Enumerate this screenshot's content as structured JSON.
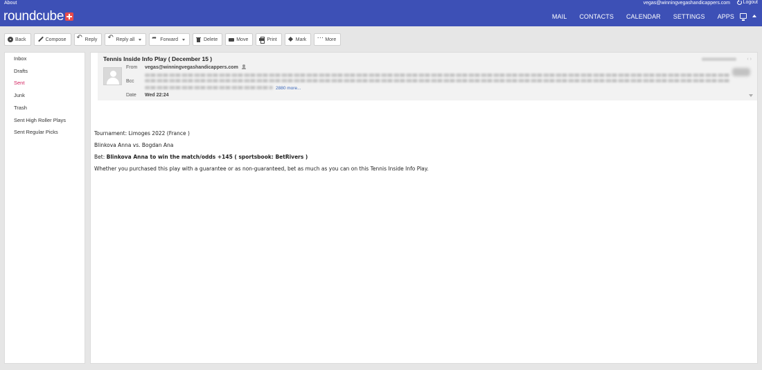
{
  "app": {
    "about_label": "About",
    "user_email": "vegas@winningvegashandicappers.com",
    "logout_label": "Logout",
    "logo_text": "roundcube",
    "nav": [
      "MAIL",
      "CONTACTS",
      "CALENDAR",
      "SETTINGS",
      "APPS"
    ]
  },
  "toolbar": {
    "back": "Back",
    "compose": "Compose",
    "reply": "Reply",
    "reply_all": "Reply all",
    "forward": "Forward",
    "delete": "Delete",
    "move": "Move",
    "print": "Print",
    "mark": "Mark",
    "more": "More"
  },
  "folders": [
    {
      "label": "Inbox",
      "active": false
    },
    {
      "label": "Drafts",
      "active": false
    },
    {
      "label": "Sent",
      "active": true
    },
    {
      "label": "Junk",
      "active": false
    },
    {
      "label": "Trash",
      "active": false
    },
    {
      "label": "Sent High Roller Plays",
      "active": false
    },
    {
      "label": "Sent Regular Picks",
      "active": false
    }
  ],
  "message": {
    "subject": "Tennis Inside Info Play ( December 15 )",
    "from_label": "From",
    "from": "vegas@winningvegashandicappers.com",
    "bcc_label": "Bcc",
    "bcc_more": "2880 more...",
    "date_label": "Date",
    "date": "Wed 22:24",
    "body": {
      "tournament": "Tournament: Limoges 2022 (France )",
      "match": "Blinkova Anna vs. Bogdan Ana",
      "bet_prefix": "Bet: ",
      "bet": "Blinkova Anna to win the match/odds +145 ( sportsbook: BetRivers )",
      "note": "Whether you purchased this play with a guarantee or as non-guaranteed, bet as much as you can on this Tennis Inside Info Play."
    }
  }
}
